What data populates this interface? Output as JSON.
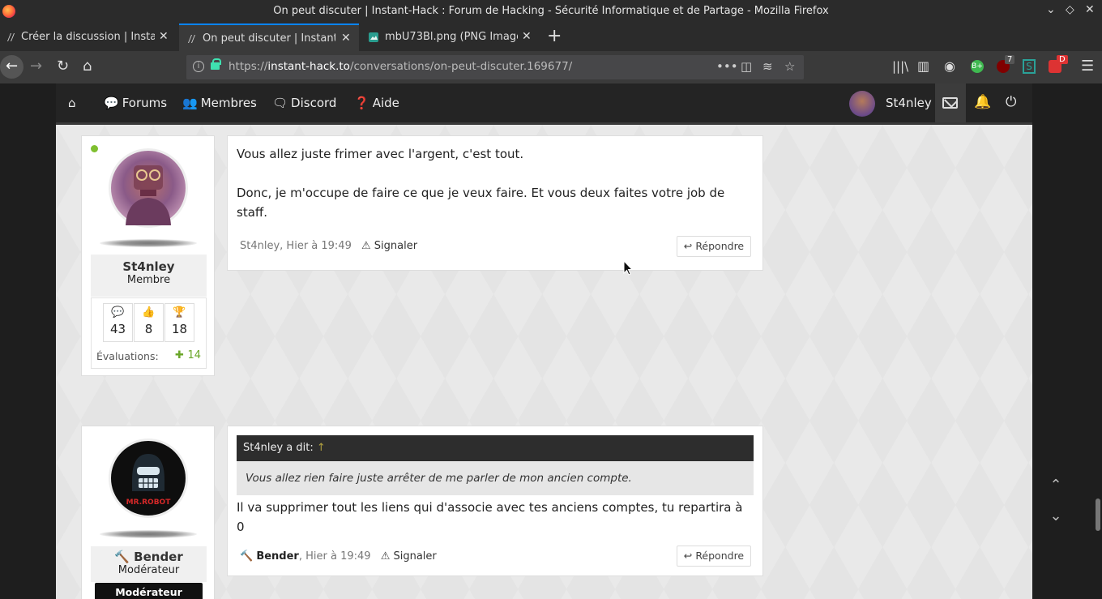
{
  "window": {
    "title": "On peut discuter | Instant-Hack : Forum de Hacking - Sécurité Informatique et de Partage - Mozilla Firefox"
  },
  "tabs": [
    {
      "label": "Créer la discussion | Instan"
    },
    {
      "label": "On peut discuter | Instant-"
    },
    {
      "label": "mbU73Bl.png (PNG Image"
    }
  ],
  "urlbar": {
    "url_prefix": "https://",
    "url_host": "instant-hack.to",
    "url_path": "/conversations/on-peut-discuter.169677/"
  },
  "toolbar_badges": {
    "ublock_count": "7",
    "extension_badge": "D"
  },
  "site_nav": {
    "forums": "Forums",
    "membres": "Membres",
    "discord": "Discord",
    "aide": "Aide",
    "username": "St4nley"
  },
  "posts": [
    {
      "user": {
        "name": "St4nley",
        "role": "Membre",
        "messages": "43",
        "likes": "8",
        "trophies": "18",
        "eval_label": "Évaluations:",
        "eval_value": "14"
      },
      "lines": [
        "Vous allez juste frimer avec l'argent, c'est tout.",
        "Donc, je m'occupe de faire ce que je veux faire. Et vous deux faites votre job de",
        "staff."
      ],
      "meta": "St4nley, Hier à 19:49",
      "report": "Signaler",
      "reply": "Répondre"
    },
    {
      "user": {
        "name": "Bender",
        "role": "Modérateur",
        "badge": "Modérateur",
        "avatar_text": "MR.ROBOT"
      },
      "quote_author": "St4nley a dit:",
      "quote_arrow": "↑",
      "quote_text": "Vous allez rien faire juste arrêter de me parler de mon ancien compte.",
      "lines": [
        "Il va supprimer tout les liens qui d'associe avec tes anciens comptes, tu repartira à",
        "0"
      ],
      "meta_author": "Bender",
      "meta_time": ", Hier à 19:49",
      "report": "Signaler",
      "reply": "Répondre"
    }
  ]
}
